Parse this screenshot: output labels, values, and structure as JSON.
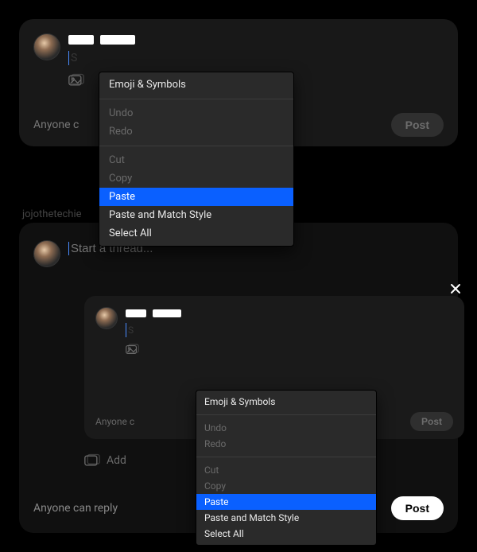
{
  "composer1": {
    "placeholder": "Start a thread...",
    "reply_scope": "Anyone c",
    "post_label": "Post"
  },
  "context_menu": {
    "emoji": "Emoji & Symbols",
    "undo": "Undo",
    "redo": "Redo",
    "cut": "Cut",
    "copy": "Copy",
    "paste": "Paste",
    "paste_match": "Paste and Match Style",
    "select_all": "Select All"
  },
  "feed_username": "jojothetechie",
  "composer2": {
    "placeholder": "Start a thread...",
    "add_label": "Add",
    "reply_scope": "Anyone can reply",
    "post_label": "Post"
  },
  "nested": {
    "reply_scope": "Anyone c",
    "post_label": "Post"
  }
}
